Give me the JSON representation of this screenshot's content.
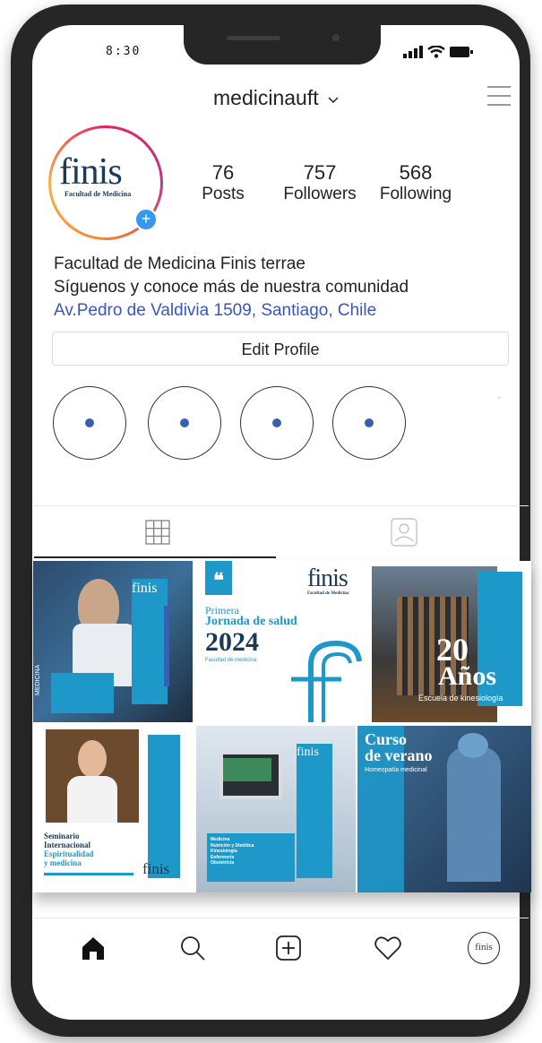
{
  "status_bar": {
    "time": "8:30"
  },
  "header": {
    "username": "medicinauft"
  },
  "profile": {
    "avatar": {
      "logo_text": "finis",
      "logo_subtitle": "Facultad de Medicina"
    },
    "stats": [
      {
        "value": "76",
        "label": "Posts"
      },
      {
        "value": "757",
        "label": "Followers"
      },
      {
        "value": "568",
        "label": "Following"
      }
    ],
    "bio": {
      "name": "Facultad de Medicina Finis terrae",
      "tagline": "Síguenos y conoce más de nuestra comunidad",
      "location": "Av.Pedro de Valdivia 1509, Santiago, Chile"
    },
    "edit_button": "Edit Profile"
  },
  "highlights_count": 4,
  "posts": {
    "p1": {
      "logo": "finis",
      "vertical": "MEDICINA"
    },
    "p2": {
      "logo": "finis",
      "logo_sub": "Facultad de Medicina",
      "quote": "66",
      "kicker": "Primera",
      "title": "Jornada de salud",
      "year": "2024",
      "footer": "Facultad de medicina"
    },
    "p3": {
      "number": "20",
      "word": "Años",
      "caption": "Escuela de kinesiología"
    },
    "p4": {
      "line1": "Seminario",
      "line2": "Internacional",
      "line3": "Espiritualidad",
      "line4": "y medicina",
      "logo": "finis"
    },
    "p5": {
      "logo": "finis",
      "vertical": "MEDICINA",
      "list1": "Medicina",
      "list2": "Nutrición y Dietética",
      "list3": "Kinesiología",
      "list4": "Enfermería",
      "list5": "Obstetricia"
    },
    "p6": {
      "line1": "Curso",
      "line2": "de verano",
      "sub": "Homeopatía medicinal"
    }
  },
  "colors": {
    "brand_blue": "#1e97c9",
    "dark_navy": "#1a3a55",
    "link_blue": "#3a55c4",
    "accent_blue": "#3897f0"
  },
  "bottom_nav": [
    "home-icon",
    "search-icon",
    "add-post-icon",
    "heart-icon",
    "profile-avatar-icon"
  ],
  "bottom_nav_avatar_text": "finis"
}
